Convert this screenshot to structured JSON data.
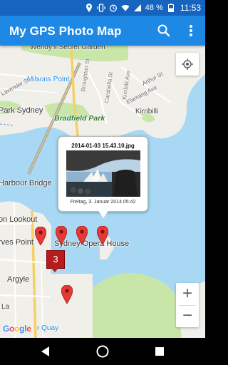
{
  "status_bar": {
    "battery": "48 %",
    "time": "11:53",
    "icons": [
      "location-icon",
      "vibrate-icon",
      "alarm-icon",
      "wifi-icon",
      "signal-icon",
      "battery-icon"
    ]
  },
  "app_bar": {
    "title": "My GPS Photo Map",
    "search_icon": "search-icon",
    "overflow_icon": "more-vert-icon"
  },
  "map": {
    "labels": {
      "wendys": "Wendy's Secret Garden",
      "milsons": "Milsons Point",
      "park_sydney": "Park Sydney",
      "bradfield": "Bradfield Park",
      "kirribilli": "Kirribilli",
      "harbour_bridge": "Harbour Bridge",
      "lookout": "on Lookout",
      "rves_point": "rves Point",
      "opera_house": "Sydney Opera House",
      "argyle": "Argyle",
      "quay": "r Quay",
      "la": "La",
      "broughton": "Broughton St",
      "kirribilli_ave": "Kirribilli Ave",
      "carabella": "Carabella St",
      "elamang": "Elamang Ave",
      "arthur": "Arthur St",
      "lavender": "Lavender St"
    },
    "attribution": "Google",
    "cluster_count": "3",
    "zoom_in": "+",
    "zoom_out": "−"
  },
  "popup": {
    "filename": "2014-01-03 15.43.10.jpg",
    "date": "Freitag, 3. Januar 2014 05:42"
  },
  "nav_bar": {
    "back": "back-icon",
    "home": "home-icon",
    "recents": "recents-icon"
  },
  "colors": {
    "status_bar": "#1565c0",
    "app_bar": "#1e88e5",
    "water": "#a8d8f3",
    "land": "#f1efe9",
    "park": "#c8e6a8",
    "marker": "#e53935",
    "cluster": "#b71c1c"
  }
}
